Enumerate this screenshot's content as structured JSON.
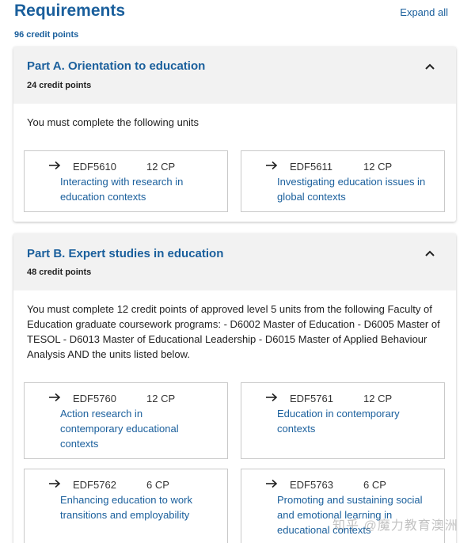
{
  "header": {
    "title": "Requirements",
    "expand_all": "Expand all",
    "total_credit_points": "96 credit points"
  },
  "sections": [
    {
      "title": "Part A. Orientation to education",
      "credit_points": "24 credit points",
      "description": "You must complete the following units",
      "units": [
        {
          "code": "EDF5610",
          "cp": "12 CP",
          "name": "Interacting with research in education contexts"
        },
        {
          "code": "EDF5611",
          "cp": "12 CP",
          "name": "Investigating education issues in global contexts"
        }
      ]
    },
    {
      "title": "Part B. Expert studies in education",
      "credit_points": "48 credit points",
      "description": "You must complete 12 credit points of approved level 5 units from the following Faculty of Education graduate coursework programs: - D6002 Master of Education - D6005 Master of TESOL - D6013 Master of Educational Leadership - D6015 Master of Applied Behaviour Analysis AND the units listed below.",
      "units": [
        {
          "code": "EDF5760",
          "cp": "12 CP",
          "name": "Action research in contemporary educational contexts"
        },
        {
          "code": "EDF5761",
          "cp": "12 CP",
          "name": "Education in contemporary contexts"
        },
        {
          "code": "EDF5762",
          "cp": "6 CP",
          "name": "Enhancing education to work transitions and employability"
        },
        {
          "code": "EDF5763",
          "cp": "6 CP",
          "name": "Promoting and sustaining social and emotional learning in educational contexts"
        }
      ]
    }
  ],
  "watermark": "知乎 @魔力教育澳洲"
}
